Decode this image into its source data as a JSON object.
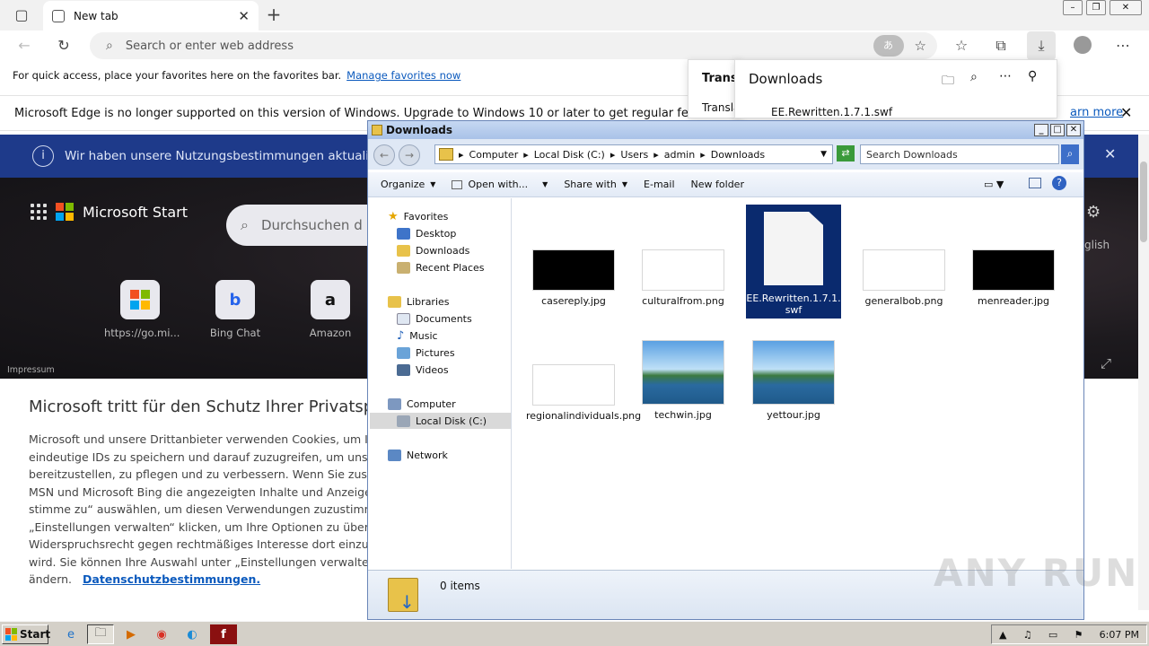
{
  "browser": {
    "tab_title": "New tab",
    "address_placeholder": "Search or enter web address",
    "favorites_hint": "For quick access, place your favorites here on the favorites bar.",
    "favorites_link": "Manage favorites now",
    "upgrade_message": "Microsoft Edge is no longer supported on this version of Windows. Upgrade to Windows 10 or later to get regular feature and",
    "upgrade_link": "arn more"
  },
  "downloads_flyout": {
    "title": "Downloads",
    "item": "EE.Rewritten.1.7.1.swf",
    "translate_label": "Transl",
    "translate_sub": "Translat"
  },
  "msn": {
    "info_text": "Wir haben unsere Nutzungsbestimmungen aktualisiert",
    "brand": "Microsoft Start",
    "search_placeholder": "Durchsuchen d",
    "quicklinks": [
      {
        "label": "https://go.mi..."
      },
      {
        "label": "Bing Chat"
      },
      {
        "label": "Amazon"
      }
    ],
    "lang": "glish",
    "impressum": "Impressum",
    "privacy_title": "Microsoft tritt für den Schutz Ihrer Privatsph",
    "privacy_lines": [
      "Microsoft und unsere Drittanbieter verwenden Cookies, um Infor",
      "eindeutige IDs zu speichern und darauf zuzugreifen, um unsere D",
      "bereitzustellen, zu pflegen und zu verbessern. Wenn Sie zustimm",
      "MSN und Microsoft Bing die angezeigten Inhalte und Anzeigen. S",
      "stimme zu“ auswählen, um diesen Verwendungen zuzustimmen, o",
      "„Einstellungen verwalten“ klicken, um Ihre Optionen zu überprüfe",
      "Widerspruchsrecht gegen rechtmäßiges Interesse dort einzulege",
      "wird.  Sie können Ihre Auswahl unter „Einstellungen verwalten“ un"
    ],
    "privacy_last_prefix": "ändern.",
    "privacy_link": "Datenschutzbestimmungen."
  },
  "explorer": {
    "title": "Downloads",
    "breadcrumb": [
      "Computer",
      "Local Disk (C:)",
      "Users",
      "admin",
      "Downloads"
    ],
    "search_placeholder": "Search Downloads",
    "toolbar": {
      "organize": "Organize",
      "open_with": "Open with...",
      "share_with": "Share with",
      "email": "E-mail",
      "new_folder": "New folder"
    },
    "nav": {
      "favorites": "Favorites",
      "desktop": "Desktop",
      "downloads": "Downloads",
      "recent": "Recent Places",
      "libraries": "Libraries",
      "documents": "Documents",
      "music": "Music",
      "pictures": "Pictures",
      "videos": "Videos",
      "computer": "Computer",
      "local_disk": "Local Disk (C:)",
      "network": "Network"
    },
    "files": [
      {
        "name": "casereply.jpg"
      },
      {
        "name": "culturalfrom.png"
      },
      {
        "name": "EE.Rewritten.1.7.1.swf"
      },
      {
        "name": "generalbob.png"
      },
      {
        "name": "menreader.jpg"
      },
      {
        "name": "regionalindividuals.png"
      },
      {
        "name": "techwin.jpg"
      },
      {
        "name": "yettour.jpg"
      }
    ],
    "status": "0 items"
  },
  "taskbar": {
    "start": "Start",
    "clock": "6:07 PM"
  },
  "watermark": "ANY RUN"
}
